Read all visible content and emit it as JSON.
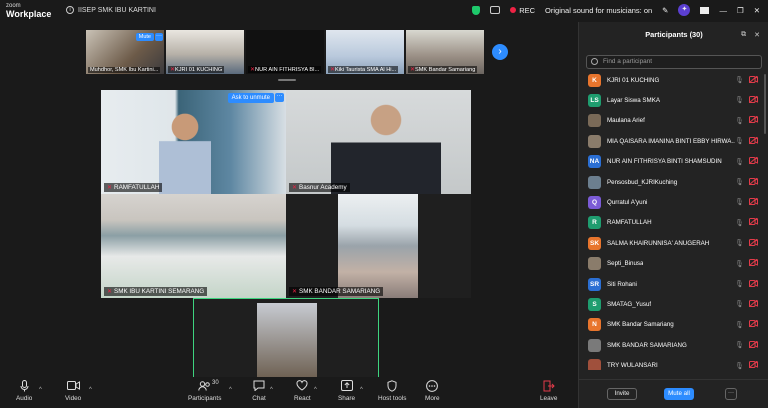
{
  "titlebar": {
    "logo_line1": "zoom",
    "logo_line2": "Workplace",
    "info_icon": "info-icon",
    "meeting_title": "IISEP SMK IBU KARTINI",
    "rec_label": "REC",
    "audio_status": "Original sound for musicians: on"
  },
  "strip": {
    "thumbs": [
      {
        "name": "Muhdhor, SMK Ibu Kartini...",
        "mute_label": "Mute"
      },
      {
        "name": "KJRI 01 KUCHING"
      },
      {
        "name": "NUR AIN FITHRISYA BI..."
      },
      {
        "name": "Kiki Taurista SMA Al Hi..."
      },
      {
        "name": "SMK Bandar Samariang"
      }
    ],
    "more_label": "···",
    "next_label": "›"
  },
  "grid": {
    "tiles": [
      {
        "name": "RAMFATULLAH",
        "unmute_label": "Ask to unmute",
        "more_label": "···"
      },
      {
        "name": "Basnur Academy"
      },
      {
        "name": "SMK IBU KARTINI SEMARANG"
      },
      {
        "name": "SMK BANDAR SAMARIANG"
      }
    ]
  },
  "toolbar": {
    "audio": "Audio",
    "video": "Video",
    "participants": "Participants",
    "participant_count": "30",
    "chat": "Chat",
    "react": "React",
    "share": "Share",
    "host_tools": "Host tools",
    "more": "More",
    "leave": "Leave"
  },
  "panel": {
    "title": "Participants (30)",
    "search_placeholder": "Find a participant",
    "participants": [
      {
        "name": "KJRI 01 KUCHING",
        "initial": "K",
        "color": "#e8752d"
      },
      {
        "name": "Layar Siswa SMKA",
        "initial": "LS",
        "color": "#1f9d6f"
      },
      {
        "name": "Maulana Arief",
        "initial": "",
        "color": "#7a6a58"
      },
      {
        "name": "MIA QAISARA IMANINA BINTI EBBY HIRWA...",
        "initial": "",
        "color": "#8a7c6b"
      },
      {
        "name": "NUR AIN FITHRISYA BINTI SHAMSUDIN",
        "initial": "NA",
        "color": "#2b6fd4"
      },
      {
        "name": "Pensosbud_KJRIKuching",
        "initial": "",
        "color": "#6c7f8f"
      },
      {
        "name": "Qurratul A'yuni",
        "initial": "Q",
        "color": "#7b5bd6"
      },
      {
        "name": "RAMFATULLAH",
        "initial": "R",
        "color": "#1f9d6f"
      },
      {
        "name": "SALMA KHAIRUNNISA' ANUGERAH",
        "initial": "SK",
        "color": "#e8752d"
      },
      {
        "name": "Septi_Binusa",
        "initial": "",
        "color": "#8a7c6b"
      },
      {
        "name": "Siti Rohani",
        "initial": "SR",
        "color": "#2b6fd4"
      },
      {
        "name": "SMATAG_Yusuf",
        "initial": "S",
        "color": "#1f9d6f"
      },
      {
        "name": "SMK Bandar Samariang",
        "initial": "N",
        "color": "#e8752d"
      },
      {
        "name": "SMK BANDAR SAMARIANG",
        "initial": "",
        "color": "#7a7a7a"
      },
      {
        "name": "TRY WULANSARI",
        "initial": "",
        "color": "#a0503c"
      }
    ],
    "invite_label": "Invite",
    "mute_all_label": "Mute all",
    "more_label": "···"
  }
}
